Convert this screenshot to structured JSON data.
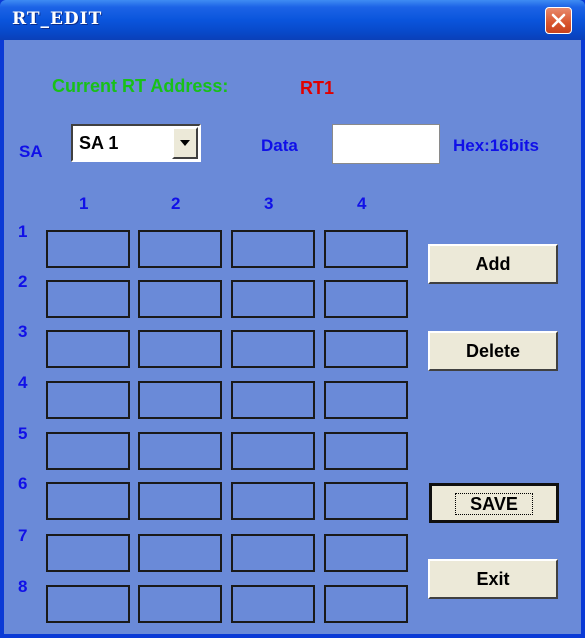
{
  "window": {
    "title": "RT_EDIT"
  },
  "header": {
    "address_label": "Current  RT Address:",
    "address_value": "RT1"
  },
  "controls": {
    "sa_label": "SA",
    "sa_value": "SA 1",
    "data_label": "Data",
    "data_value": "",
    "hex_label": "Hex:16bits"
  },
  "grid": {
    "col_headers": [
      "1",
      "2",
      "3",
      "4"
    ],
    "row_headers": [
      "1",
      "2",
      "3",
      "4",
      "5",
      "6",
      "7",
      "8"
    ]
  },
  "buttons": {
    "add": "Add",
    "delete": "Delete",
    "save": "SAVE",
    "exit": "Exit"
  },
  "colors": {
    "client_bg": "#6a8ad8",
    "address_label": "#18c018",
    "address_value": "#e00000",
    "labels": "#1010e8"
  },
  "icons": {
    "close": "close-icon",
    "dropdown": "chevron-down-icon"
  }
}
